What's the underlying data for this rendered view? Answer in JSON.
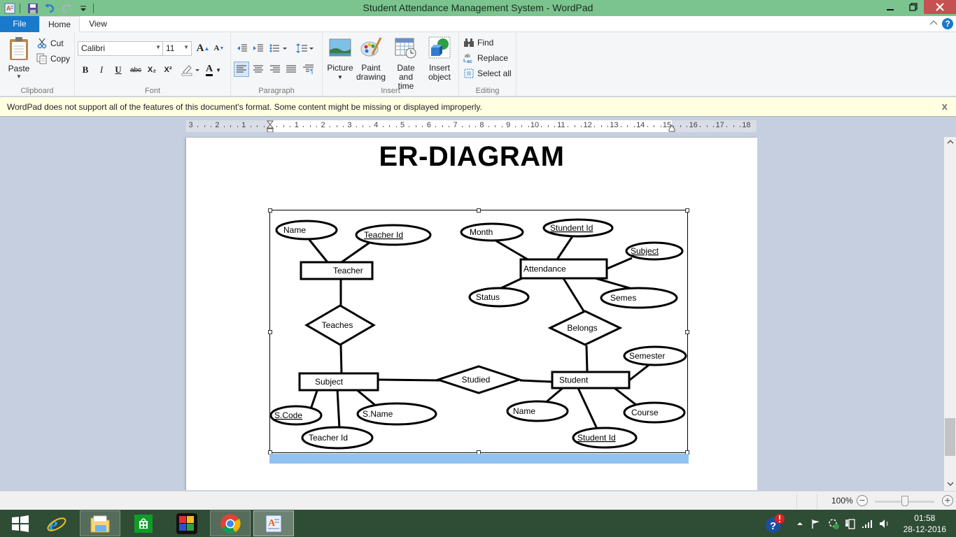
{
  "window": {
    "title": "Student Attendance Management System - WordPad",
    "minimize": "minimize",
    "maximize": "restore",
    "close": "close"
  },
  "quick_access": [
    {
      "icon": "wordpad-app-icon"
    },
    {
      "icon": "save-icon"
    },
    {
      "icon": "undo-icon"
    },
    {
      "icon": "redo-icon"
    },
    {
      "icon": "customize-dropdown-icon"
    }
  ],
  "tabs": [
    {
      "label": "File",
      "active": false
    },
    {
      "label": "Home",
      "active": true
    },
    {
      "label": "View",
      "active": false
    }
  ],
  "ribbon": {
    "clipboard": {
      "label": "Clipboard",
      "paste": "Paste",
      "cut": "Cut",
      "copy": "Copy"
    },
    "font": {
      "label": "Font",
      "font_name": "Calibri",
      "font_size": "11",
      "grow": "A",
      "shrink": "A",
      "bold": "B",
      "italic": "I",
      "underline": "U",
      "strike": "abc",
      "subscript": "X₂",
      "superscript": "X²",
      "font_color": "A"
    },
    "paragraph": {
      "label": "Paragraph"
    },
    "insert": {
      "label": "Insert",
      "picture": "Picture",
      "paint_line1": "Paint",
      "paint_line2": "drawing",
      "datetime_line1": "Date and",
      "datetime_line2": "time",
      "object_line1": "Insert",
      "object_line2": "object"
    },
    "editing": {
      "label": "Editing",
      "find": "Find",
      "replace": "Replace",
      "select_all": "Select all"
    }
  },
  "notification": {
    "text": "WordPad does not support all of the features of this document's format. Some content might be missing or displayed improperly.",
    "close": "x"
  },
  "ruler": {
    "labels": [
      "3",
      "2",
      "1",
      "1",
      "2",
      "3",
      "4",
      "5",
      "6",
      "7",
      "8",
      "9",
      "10",
      "11",
      "12",
      "13",
      "14",
      "15",
      "16",
      "17",
      "18"
    ]
  },
  "document": {
    "title": "ER-DIAGRAM",
    "er_diagram": {
      "entities": [
        {
          "name": "Teacher"
        },
        {
          "name": "Attendance"
        },
        {
          "name": "Subject"
        },
        {
          "name": "Student"
        }
      ],
      "relationships": [
        {
          "name": "Teaches",
          "connects": [
            "Teacher",
            "Subject"
          ]
        },
        {
          "name": "Belongs",
          "connects": [
            "Attendance",
            "Student"
          ]
        },
        {
          "name": "Studied",
          "connects": [
            "Subject",
            "Student"
          ]
        }
      ],
      "attributes": [
        {
          "name": "Name",
          "entity": "Teacher",
          "key": false
        },
        {
          "name": "Teacher Id",
          "entity": "Teacher",
          "key": true
        },
        {
          "name": "Month",
          "entity": "Attendance",
          "key": false
        },
        {
          "name": "Stundent Id",
          "entity": "Attendance",
          "key": true
        },
        {
          "name": "Subject",
          "entity": "Attendance",
          "key": true
        },
        {
          "name": "Status",
          "entity": "Attendance",
          "key": false
        },
        {
          "name": "Semes",
          "entity": "Attendance",
          "key": false
        },
        {
          "name": "S.Code",
          "entity": "Subject",
          "key": true
        },
        {
          "name": "Teacher Id",
          "entity": "Subject",
          "key": false
        },
        {
          "name": "S.Name",
          "entity": "Subject",
          "key": false
        },
        {
          "name": "Semester",
          "entity": "Student",
          "key": false
        },
        {
          "name": "Name",
          "entity": "Student",
          "key": false
        },
        {
          "name": "Student Id",
          "entity": "Student",
          "key": true
        },
        {
          "name": "Course",
          "entity": "Student",
          "key": false
        }
      ]
    }
  },
  "statusbar": {
    "zoom": "100%",
    "zoom_level_percent": 100
  },
  "taskbar": {
    "items": [
      {
        "name": "start"
      },
      {
        "name": "internet-explorer"
      },
      {
        "name": "file-explorer"
      },
      {
        "name": "store"
      },
      {
        "name": "puzzle-app"
      },
      {
        "name": "chrome"
      },
      {
        "name": "wordpad"
      }
    ],
    "time": "01:58",
    "date": "28-12-2016"
  }
}
